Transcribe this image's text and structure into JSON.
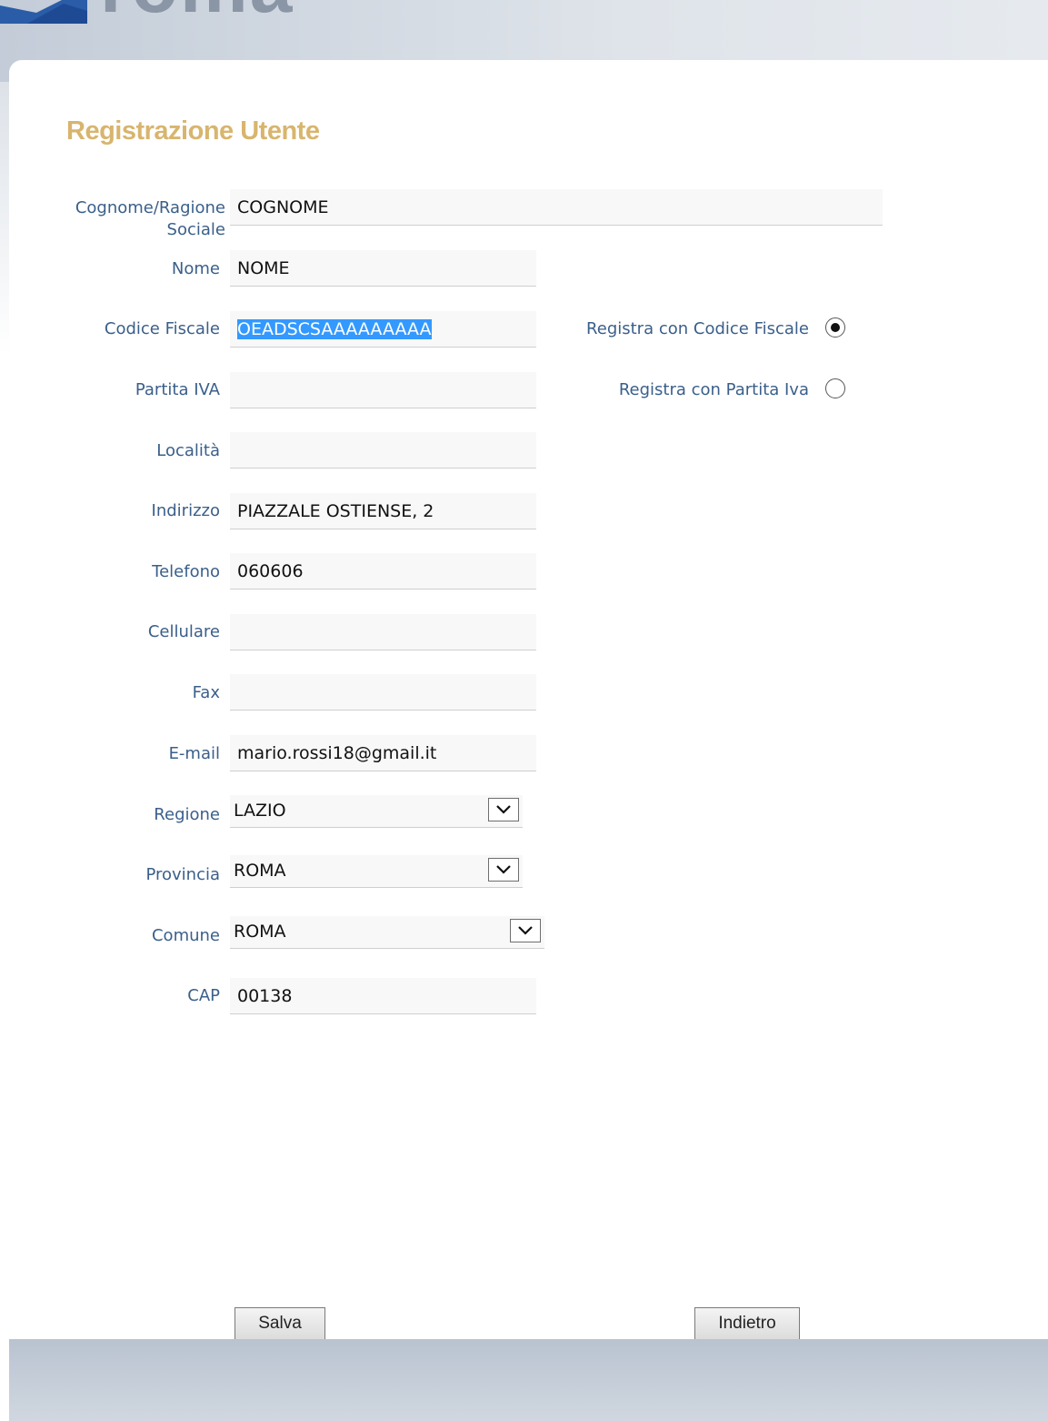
{
  "header": {
    "logo_text": "roma"
  },
  "page_title": "Registrazione Utente",
  "fields": {
    "cognome": {
      "label_line1": "Cognome/Ragione",
      "label_line2": "Sociale",
      "value": "COGNOME"
    },
    "nome": {
      "label": "Nome",
      "value": "NOME"
    },
    "codice_fiscale": {
      "label": "Codice Fiscale",
      "value": "OEADSCSAAAAAAAAA"
    },
    "partita_iva": {
      "label": "Partita IVA",
      "value": ""
    },
    "localita": {
      "label": "Località",
      "value": ""
    },
    "indirizzo": {
      "label": "Indirizzo",
      "value": "PIAZZALE  OSTIENSE, 2"
    },
    "telefono": {
      "label": "Telefono",
      "value": "060606"
    },
    "cellulare": {
      "label": "Cellulare",
      "value": ""
    },
    "fax": {
      "label": "Fax",
      "value": ""
    },
    "email": {
      "label": "E-mail",
      "value": "mario.rossi18@gmail.it"
    },
    "regione": {
      "label": "Regione",
      "value": "LAZIO"
    },
    "provincia": {
      "label": "Provincia",
      "value": "ROMA"
    },
    "comune": {
      "label": "Comune",
      "value": "ROMA"
    },
    "cap": {
      "label": "CAP",
      "value": "00138"
    }
  },
  "radios": {
    "codice_fiscale": {
      "label": "Registra con Codice Fiscale",
      "checked": true
    },
    "partita_iva": {
      "label": "Registra con Partita Iva",
      "checked": false
    }
  },
  "buttons": {
    "save": "Salva",
    "back": "Indietro"
  },
  "icons": {
    "dropdown": "chevron-down-icon",
    "logo": "roma-logo-icon"
  },
  "colors": {
    "title": "#d8b56e",
    "label": "#3a5f8a",
    "selection": "#3399ff"
  }
}
